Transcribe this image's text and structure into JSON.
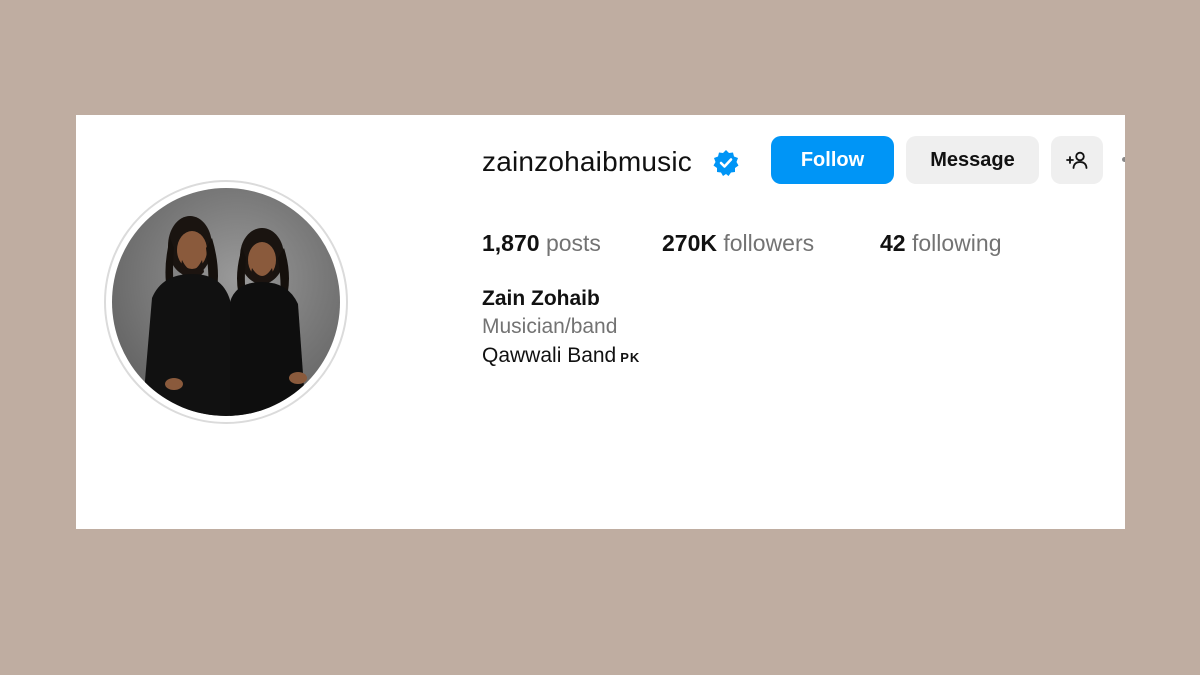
{
  "profile": {
    "username": "zainzohaibmusic",
    "verified": true,
    "verified_icon": "verified-badge-icon",
    "accent_color": "#0095f6",
    "avatar_alt": "profile-photo"
  },
  "actions": {
    "follow_label": "Follow",
    "message_label": "Message",
    "add_user_icon": "+☺"
  },
  "stats": {
    "posts_count": "1,870",
    "posts_label": "posts",
    "followers_count": "270K",
    "followers_label": "followers",
    "following_count": "42",
    "following_label": "following"
  },
  "bio": {
    "name": "Zain Zohaib",
    "category": "Musician/band",
    "text": "Qawwali Band",
    "flag": "PK"
  }
}
